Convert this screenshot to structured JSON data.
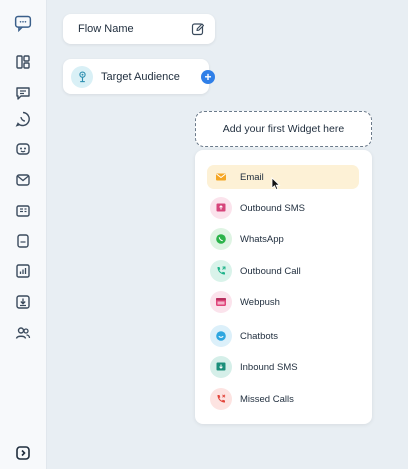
{
  "flow": {
    "name_label": "Flow Name"
  },
  "audience": {
    "label": "Target Audience"
  },
  "add_widget": {
    "label": "Add your first Widget here"
  },
  "widgets": [
    {
      "label": "Email",
      "icon": "email-icon",
      "color": "#f5a623",
      "bg": "#fdf1d6"
    },
    {
      "label": "Outbound SMS",
      "icon": "outbound-sms-icon",
      "color": "#d6457b",
      "bg": "#fbe3ec"
    },
    {
      "label": "WhatsApp",
      "icon": "whatsapp-icon",
      "color": "#2bb34a",
      "bg": "#def4e3"
    },
    {
      "label": "Outbound Call",
      "icon": "outbound-call-icon",
      "color": "#1fb38a",
      "bg": "#d9f3ea"
    },
    {
      "label": "Webpush",
      "icon": "webpush-icon",
      "color": "#e0457b",
      "bg": "#fbe3ec"
    },
    {
      "label": "Chatbots",
      "icon": "chatbot-icon",
      "color": "#2ea6e0",
      "bg": "#dcf0fa"
    },
    {
      "label": "Inbound SMS",
      "icon": "inbound-sms-icon",
      "color": "#1a8f7a",
      "bg": "#d5efe9"
    },
    {
      "label": "Missed Calls",
      "icon": "missed-call-icon",
      "color": "#e2453b",
      "bg": "#fde3e1"
    }
  ],
  "colors": {
    "accent": "#2f7fe8",
    "sidebar_bg": "#f7f9fb",
    "canvas_bg": "#e8eef3"
  }
}
